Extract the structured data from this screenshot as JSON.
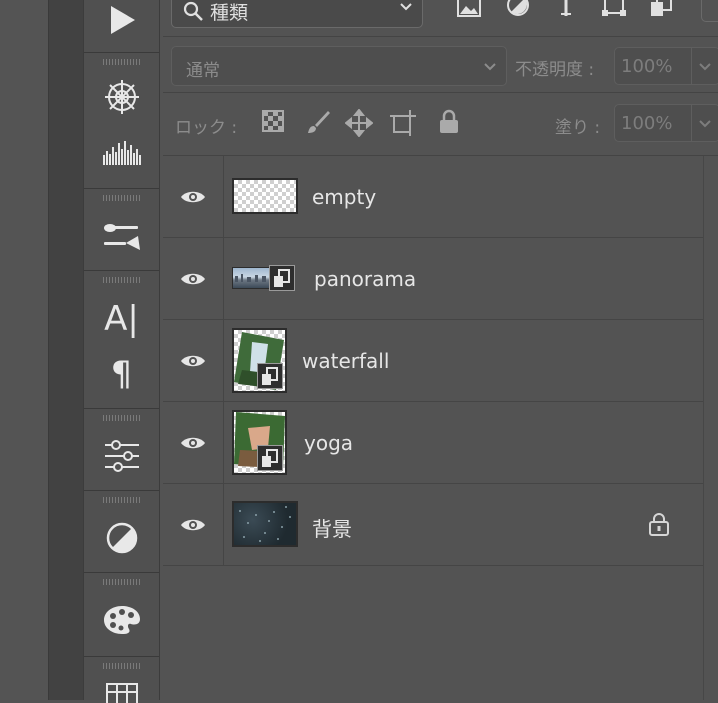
{
  "toolbar": {
    "tools": [
      "play-icon",
      "color-wheel-icon",
      "histogram-icon",
      "brush-settings-icon",
      "type-icon",
      "paragraph-icon",
      "adjustments-icon",
      "contrast-icon",
      "palette-icon",
      "grid-icon"
    ],
    "type_glyph": "A|",
    "paragraph_glyph": "¶"
  },
  "filter": {
    "kind_label": "種類",
    "icons": [
      "image-filter-icon",
      "adjustment-filter-icon",
      "type-filter-icon",
      "shape-filter-icon",
      "smart-object-filter-icon"
    ]
  },
  "blend": {
    "mode": "通常",
    "opacity_label": "不透明度 :",
    "opacity_value": "100%"
  },
  "lock": {
    "label": "ロック :",
    "fill_label": "塗り :",
    "fill_value": "100%"
  },
  "layers": [
    {
      "name": "empty",
      "visible": true,
      "thumb": "transparent",
      "smart": false,
      "locked": false
    },
    {
      "name": "panorama",
      "visible": true,
      "thumb": "panorama",
      "smart": true,
      "locked": false
    },
    {
      "name": "waterfall",
      "visible": true,
      "thumb": "waterfall",
      "smart": true,
      "locked": false
    },
    {
      "name": "yoga",
      "visible": true,
      "thumb": "yoga",
      "smart": true,
      "locked": false
    },
    {
      "name": "背景",
      "visible": true,
      "thumb": "background",
      "smart": false,
      "locked": true
    }
  ],
  "colors": {
    "panel_bg": "#535353",
    "toolbar_bg": "#505050",
    "text": "#e6e6e6",
    "muted_text": "#8c8c8c"
  }
}
